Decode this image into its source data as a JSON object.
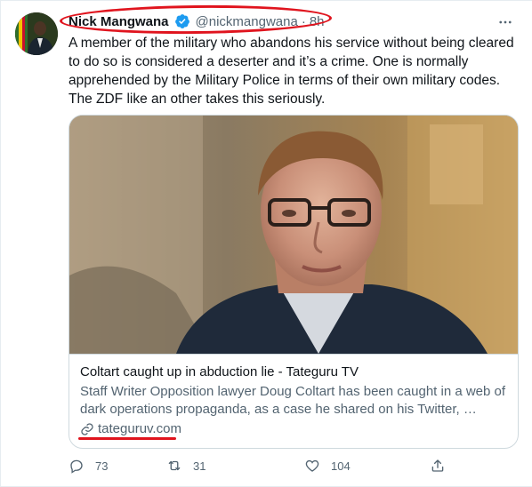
{
  "tweet": {
    "author_name": "Nick Mangwana",
    "handle": "@nickmangwana",
    "separator": "·",
    "time": "8h",
    "more_icon": "more-horizontal-icon",
    "verified_icon": "verified-badge-icon",
    "text": "A member of the military who abandons his service without being cleared to do so is considered a deserter and it’s a crime. One is normally apprehended by the Military Police in terms of their own military codes. The ZDF like an other takes this seriously.",
    "card": {
      "title": "Coltart caught up in abduction lie - Tateguru TV",
      "description": "Staff Writer Opposition lawyer Doug Coltart has been caught in a web of dark operations propaganda, as a case he shared on his Twitter, …",
      "link": "tateguruv.com",
      "link_icon": "link-icon"
    },
    "actions": {
      "reply_count": "73",
      "retweet_count": "31",
      "like_count": "104"
    }
  },
  "colors": {
    "annotation_red": "#e0141e",
    "verified_blue": "#1d9bf0",
    "secondary_text": "#536471"
  }
}
